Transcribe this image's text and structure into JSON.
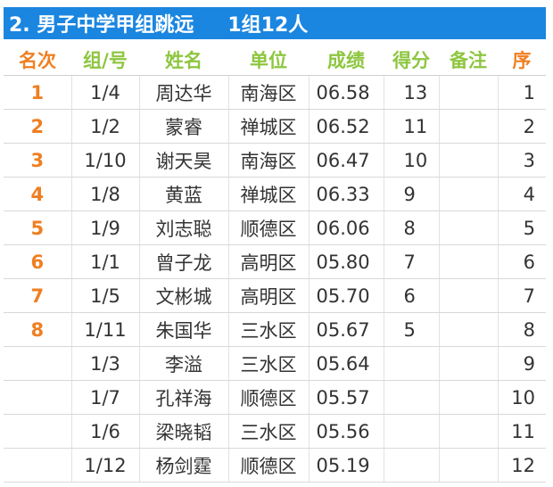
{
  "header": {
    "event": "2. 男子中学甲组跳远",
    "group": "1组12人"
  },
  "columns": [
    "名次",
    "组/号",
    "姓名",
    "单位",
    "成绩",
    "得分",
    "备注",
    "序"
  ],
  "rows": [
    {
      "rank": "1",
      "group_no": "1/4",
      "name": "周达华",
      "unit": "南海区",
      "score": "06.58",
      "points": "13",
      "note": "",
      "seq": "1"
    },
    {
      "rank": "2",
      "group_no": "1/2",
      "name": "蒙睿",
      "unit": "禅城区",
      "score": "06.52",
      "points": "11",
      "note": "",
      "seq": "2"
    },
    {
      "rank": "3",
      "group_no": "1/10",
      "name": "谢天昊",
      "unit": "南海区",
      "score": "06.47",
      "points": "10",
      "note": "",
      "seq": "3"
    },
    {
      "rank": "4",
      "group_no": "1/8",
      "name": "黄蓝",
      "unit": "禅城区",
      "score": "06.33",
      "points": "9",
      "note": "",
      "seq": "4"
    },
    {
      "rank": "5",
      "group_no": "1/9",
      "name": "刘志聪",
      "unit": "顺德区",
      "score": "06.06",
      "points": "8",
      "note": "",
      "seq": "5"
    },
    {
      "rank": "6",
      "group_no": "1/1",
      "name": "曾子龙",
      "unit": "高明区",
      "score": "05.80",
      "points": "7",
      "note": "",
      "seq": "6"
    },
    {
      "rank": "7",
      "group_no": "1/5",
      "name": "文彬城",
      "unit": "高明区",
      "score": "05.70",
      "points": "6",
      "note": "",
      "seq": "7"
    },
    {
      "rank": "8",
      "group_no": "1/11",
      "name": "朱国华",
      "unit": "三水区",
      "score": "05.67",
      "points": "5",
      "note": "",
      "seq": "8"
    },
    {
      "rank": "",
      "group_no": "1/3",
      "name": "李溢",
      "unit": "三水区",
      "score": "05.64",
      "points": "",
      "note": "",
      "seq": "9"
    },
    {
      "rank": "",
      "group_no": "1/7",
      "name": "孔祥海",
      "unit": "顺德区",
      "score": "05.57",
      "points": "",
      "note": "",
      "seq": "10"
    },
    {
      "rank": "",
      "group_no": "1/6",
      "name": "梁晓韬",
      "unit": "三水区",
      "score": "05.56",
      "points": "",
      "note": "",
      "seq": "11"
    },
    {
      "rank": "",
      "group_no": "1/12",
      "name": "杨剑霆",
      "unit": "顺德区",
      "score": "05.19",
      "points": "",
      "note": "",
      "seq": "12"
    }
  ],
  "colors": {
    "title_bg": "#1b86e0",
    "rank_orange": "#ef7f22",
    "header_green": "#8dc63f"
  }
}
